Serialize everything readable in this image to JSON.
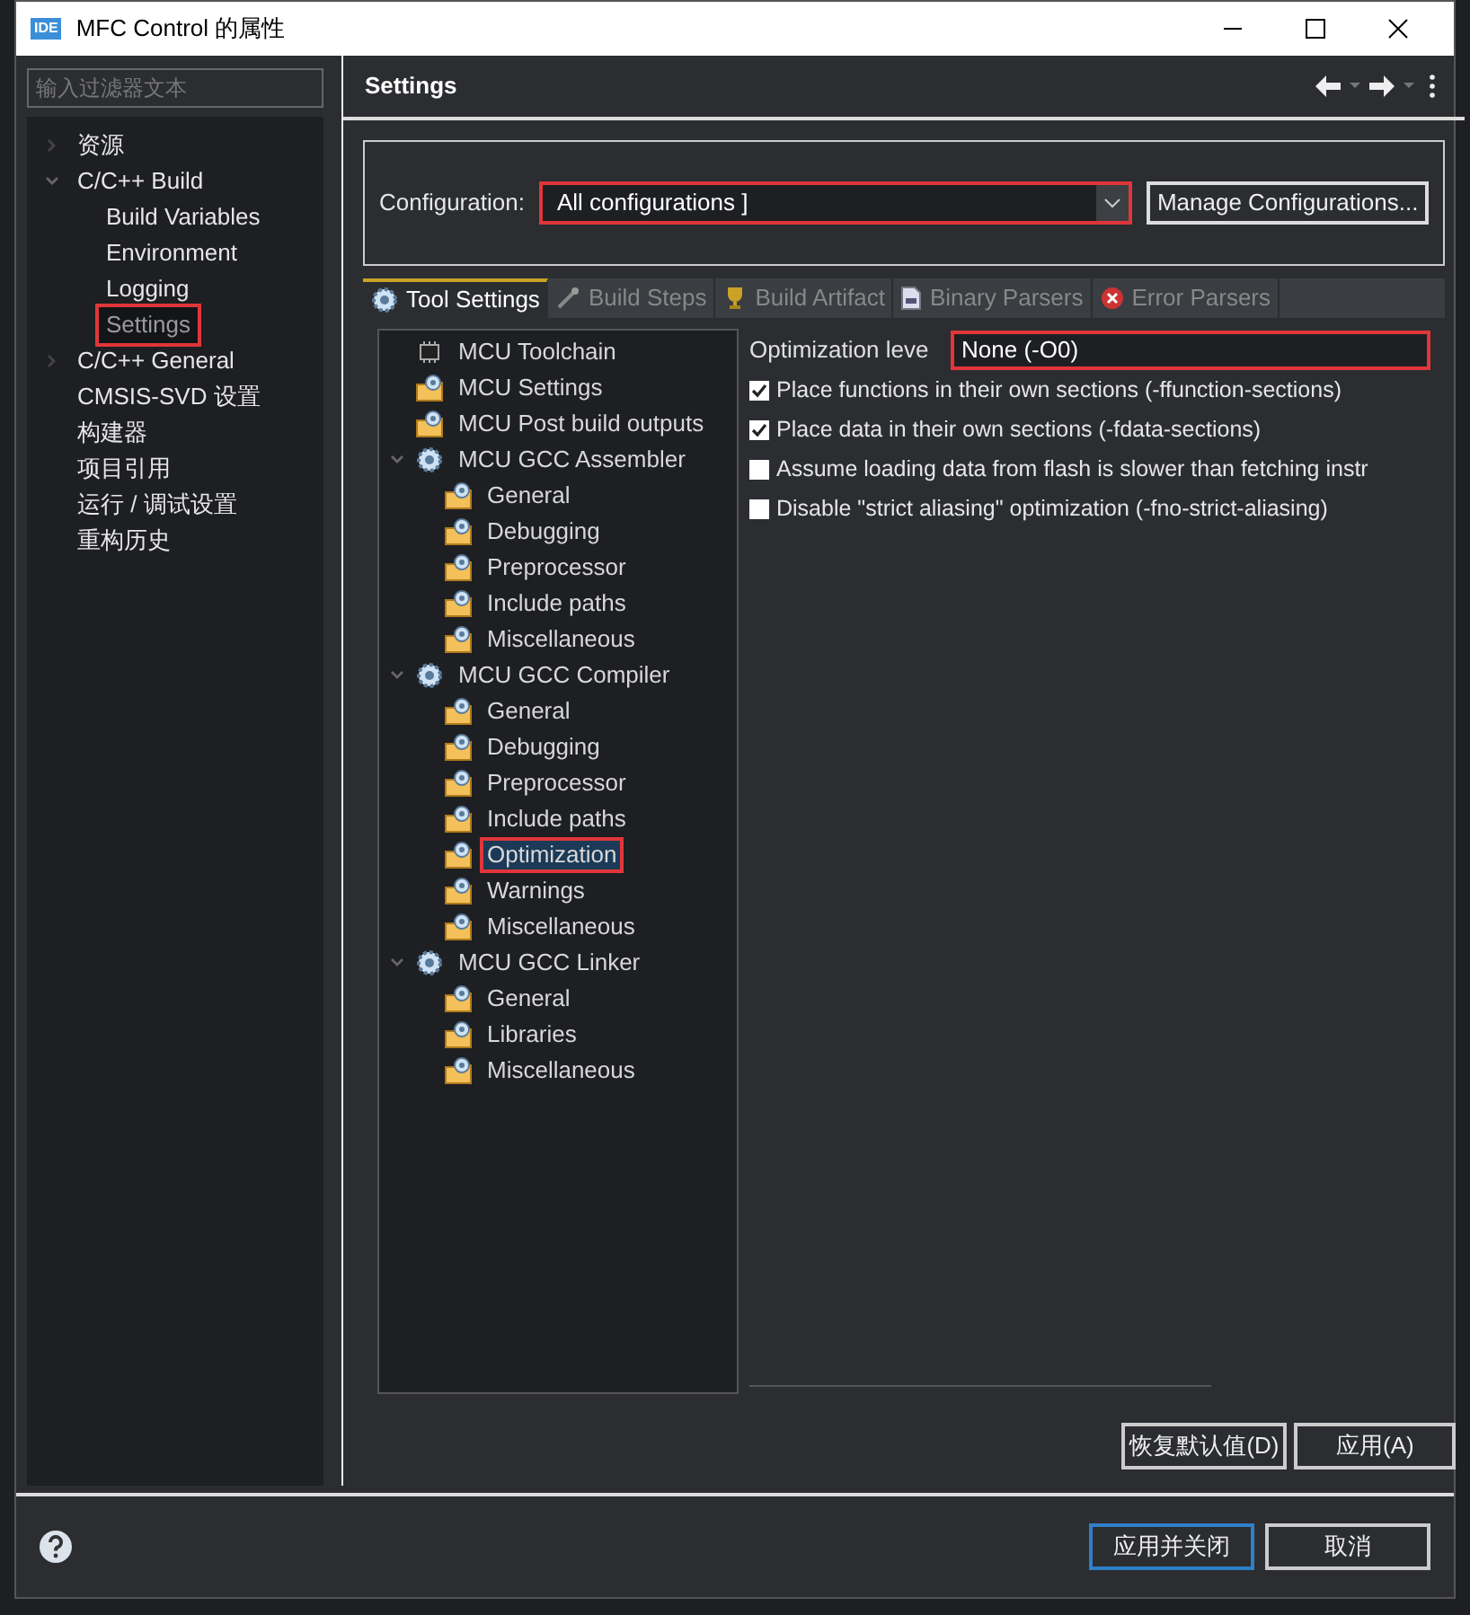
{
  "window": {
    "title": "MFC Control 的属性",
    "icon_text": "IDE"
  },
  "filter": {
    "placeholder": "输入过滤器文本"
  },
  "nav": [
    {
      "label": "资源",
      "expanded": false,
      "selected": false,
      "highlighted": false
    },
    {
      "label": "C/C++ Build",
      "expanded": true,
      "selected": false,
      "highlighted": false,
      "children": [
        {
          "label": "Build Variables",
          "selected": false,
          "highlighted": false
        },
        {
          "label": "Environment",
          "selected": false,
          "highlighted": false
        },
        {
          "label": "Logging",
          "selected": false,
          "highlighted": false
        },
        {
          "label": "Settings",
          "selected": true,
          "highlighted": true
        }
      ]
    },
    {
      "label": "C/C++ General",
      "expanded": false,
      "selected": false,
      "highlighted": false
    },
    {
      "label": "CMSIS-SVD 设置",
      "selected": false,
      "highlighted": false
    },
    {
      "label": "构建器",
      "selected": false,
      "highlighted": false
    },
    {
      "label": "项目引用",
      "selected": false,
      "highlighted": false
    },
    {
      "label": "运行 / 调试设置",
      "selected": false,
      "highlighted": false
    },
    {
      "label": "重构历史",
      "selected": false,
      "highlighted": false
    }
  ],
  "page": {
    "title": "Settings"
  },
  "configuration": {
    "label": "Configuration:",
    "value": "All configurations ]",
    "highlighted": true,
    "manage_button": "Manage Configurations..."
  },
  "tabs": [
    {
      "label": "Tool Settings",
      "selected": true,
      "kind": "gear"
    },
    {
      "label": "Build Steps",
      "selected": false,
      "kind": "wand"
    },
    {
      "label": "Build Artifact",
      "selected": false,
      "kind": "trophy"
    },
    {
      "label": "Binary Parsers",
      "selected": false,
      "kind": "binary"
    },
    {
      "label": "Error Parsers",
      "selected": false,
      "kind": "error"
    }
  ],
  "tool_tree": [
    {
      "label": "MCU Toolchain",
      "kind": "chip",
      "selected": false,
      "highlighted": false
    },
    {
      "label": "MCU Settings",
      "kind": "folder",
      "selected": false,
      "highlighted": false
    },
    {
      "label": "MCU Post build outputs",
      "kind": "folder",
      "selected": false,
      "highlighted": false
    },
    {
      "label": "MCU GCC Assembler",
      "kind": "gear",
      "expanded": true,
      "selected": false,
      "highlighted": false,
      "children": [
        {
          "label": "General",
          "kind": "folder",
          "selected": false,
          "highlighted": false
        },
        {
          "label": "Debugging",
          "kind": "folder",
          "selected": false,
          "highlighted": false
        },
        {
          "label": "Preprocessor",
          "kind": "folder",
          "selected": false,
          "highlighted": false
        },
        {
          "label": "Include paths",
          "kind": "folder",
          "selected": false,
          "highlighted": false
        },
        {
          "label": "Miscellaneous",
          "kind": "folder",
          "selected": false,
          "highlighted": false
        }
      ]
    },
    {
      "label": "MCU GCC Compiler",
      "kind": "gear",
      "expanded": true,
      "selected": false,
      "highlighted": false,
      "children": [
        {
          "label": "General",
          "kind": "folder",
          "selected": false,
          "highlighted": false
        },
        {
          "label": "Debugging",
          "kind": "folder",
          "selected": false,
          "highlighted": false
        },
        {
          "label": "Preprocessor",
          "kind": "folder",
          "selected": false,
          "highlighted": false
        },
        {
          "label": "Include paths",
          "kind": "folder",
          "selected": false,
          "highlighted": false
        },
        {
          "label": "Optimization",
          "kind": "folder",
          "selected": true,
          "highlighted": true
        },
        {
          "label": "Warnings",
          "kind": "folder",
          "selected": false,
          "highlighted": false
        },
        {
          "label": "Miscellaneous",
          "kind": "folder",
          "selected": false,
          "highlighted": false
        }
      ]
    },
    {
      "label": "MCU GCC Linker",
      "kind": "gear",
      "expanded": true,
      "selected": false,
      "highlighted": false,
      "children": [
        {
          "label": "General",
          "kind": "folder",
          "selected": false,
          "highlighted": false
        },
        {
          "label": "Libraries",
          "kind": "folder",
          "selected": false,
          "highlighted": false
        },
        {
          "label": "Miscellaneous",
          "kind": "folder",
          "selected": false,
          "highlighted": false
        }
      ]
    }
  ],
  "optimization": {
    "label": "Optimization leve",
    "value": "None (-O0)",
    "highlighted": true
  },
  "options": [
    {
      "label": "Place functions in their own sections (-ffunction-sections)",
      "checked": true
    },
    {
      "label": "Place data in their own sections (-fdata-sections)",
      "checked": true
    },
    {
      "label": "Assume loading data from flash is slower than fetching instr",
      "checked": false
    },
    {
      "label": "Disable \"strict aliasing\" optimization (-fno-strict-aliasing)",
      "checked": false
    }
  ],
  "page_buttons": [
    "恢复默认值(D)",
    "应用(A)"
  ],
  "dialog_buttons": [
    {
      "label": "应用并关闭",
      "default": true
    },
    {
      "label": "取消",
      "default": false
    }
  ]
}
